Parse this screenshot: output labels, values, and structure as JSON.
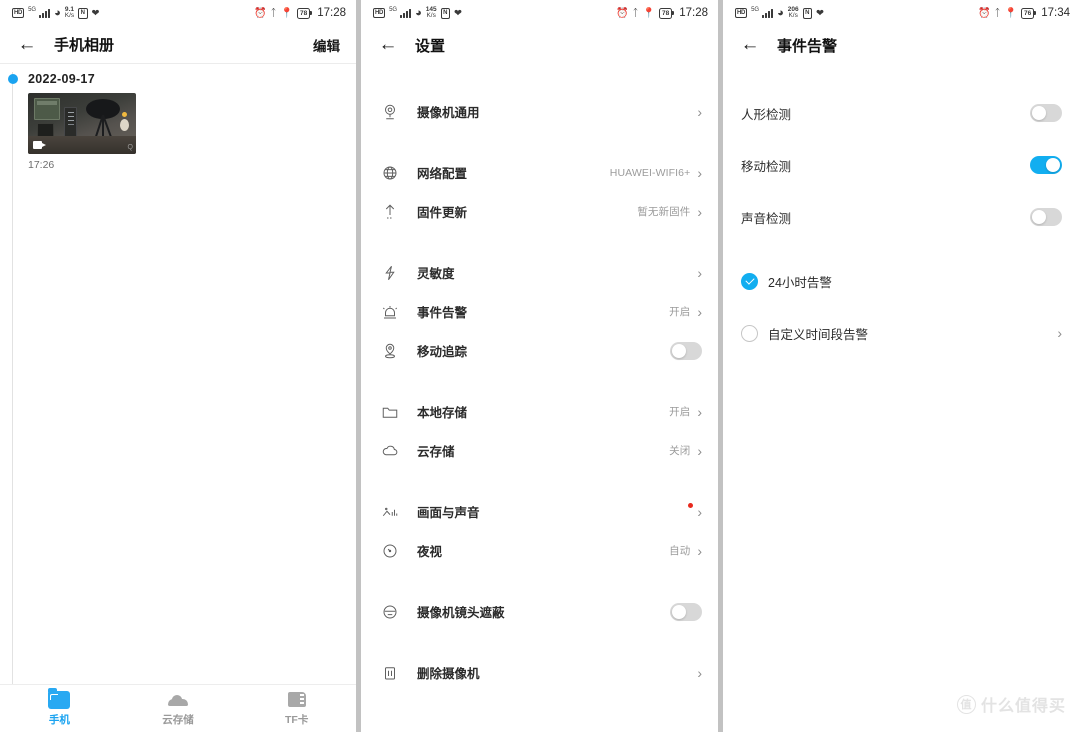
{
  "screens": {
    "album": {
      "statusbar": {
        "hd": "HD",
        "network": "5G",
        "rate_value": "9.1",
        "rate_unit": "K/s",
        "nfc": "N",
        "battery": "78",
        "time": "17:28"
      },
      "appbar": {
        "title": "手机相册",
        "action": "编辑",
        "back_icon": "back-arrow-icon"
      },
      "groups": [
        {
          "date": "2022-09-17",
          "items": [
            {
              "time": "17:26",
              "type": "video",
              "watermark": "Q"
            }
          ]
        }
      ],
      "bottom_nav": [
        {
          "label": "手机",
          "icon": "folder-icon",
          "active": true
        },
        {
          "label": "云存储",
          "icon": "cloud-icon",
          "active": false
        },
        {
          "label": "TF卡",
          "icon": "sdcard-icon",
          "active": false
        }
      ]
    },
    "settings": {
      "statusbar": {
        "hd": "HD",
        "network": "5G",
        "rate_value": "145",
        "rate_unit": "K/s",
        "nfc": "N",
        "battery": "78",
        "time": "17:28"
      },
      "appbar": {
        "title": "设置",
        "back_icon": "back-arrow-icon"
      },
      "sections": [
        {
          "rows": [
            {
              "label": "摄像机通用",
              "icon": "camera-icon",
              "value": "",
              "control": "chevron"
            }
          ]
        },
        {
          "rows": [
            {
              "label": "网络配置",
              "icon": "globe-icon",
              "value": "HUAWEI-WIFI6+",
              "control": "chevron"
            },
            {
              "label": "固件更新",
              "icon": "upload-icon",
              "value": "暂无新固件",
              "control": "chevron"
            }
          ]
        },
        {
          "rows": [
            {
              "label": "灵敏度",
              "icon": "bolt-icon",
              "value": "",
              "control": "chevron"
            },
            {
              "label": "事件告警",
              "icon": "alarm-icon",
              "value": "开启",
              "control": "chevron"
            },
            {
              "label": "移动追踪",
              "icon": "pin-icon",
              "value": "",
              "control": "toggle",
              "on": false
            }
          ]
        },
        {
          "rows": [
            {
              "label": "本地存储",
              "icon": "folder-outline-icon",
              "value": "开启",
              "control": "chevron"
            },
            {
              "label": "云存储",
              "icon": "cloud-outline-icon",
              "value": "关闭",
              "control": "chevron"
            }
          ]
        },
        {
          "rows": [
            {
              "label": "画面与声音",
              "icon": "image-sound-icon",
              "value": "",
              "control": "chevron",
              "badge": true
            },
            {
              "label": "夜视",
              "icon": "night-icon",
              "value": "自动",
              "control": "chevron"
            }
          ]
        },
        {
          "rows": [
            {
              "label": "摄像机镜头遮蔽",
              "icon": "lens-cover-icon",
              "value": "",
              "control": "toggle",
              "on": false
            }
          ]
        },
        {
          "rows": [
            {
              "label": "删除摄像机",
              "icon": "trash-icon",
              "value": "",
              "control": "chevron"
            }
          ]
        }
      ]
    },
    "alarm": {
      "statusbar": {
        "hd": "HD",
        "network": "5G",
        "rate_value": "206",
        "rate_unit": "K/s",
        "nfc": "N",
        "battery": "76",
        "time": "17:34"
      },
      "appbar": {
        "title": "事件告警",
        "back_icon": "back-arrow-icon"
      },
      "detections": [
        {
          "label": "人形检测",
          "on": false
        },
        {
          "label": "移动检测",
          "on": true
        },
        {
          "label": "声音检测",
          "on": false
        }
      ],
      "schedule": [
        {
          "label": "24小时告警",
          "checked": true,
          "chevron": false
        },
        {
          "label": "自定义时间段告警",
          "checked": false,
          "chevron": true
        }
      ]
    }
  },
  "watermark": {
    "badge": "值",
    "text": "什么值得买"
  },
  "colors": {
    "accent": "#12AEF0",
    "nav_active": "#1aa3f0",
    "badge_red": "#e8291d",
    "toggle_off": "#d8d8d8"
  }
}
